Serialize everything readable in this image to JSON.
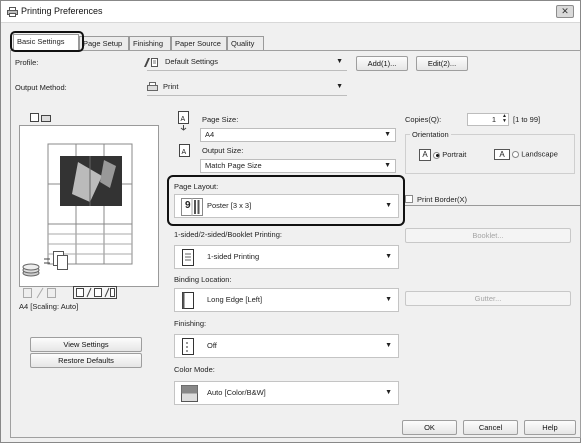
{
  "window": {
    "title": "Printing Preferences",
    "close_label": "✕"
  },
  "tabs": [
    {
      "label": "Basic Settings"
    },
    {
      "label": "Page Setup"
    },
    {
      "label": "Finishing"
    },
    {
      "label": "Paper Source"
    },
    {
      "label": "Quality"
    }
  ],
  "profile": {
    "label": "Profile:",
    "value": "Default Settings",
    "add_button": "Add(1)...",
    "edit_button": "Edit(2)..."
  },
  "output_method": {
    "label": "Output Method:",
    "value": "Print"
  },
  "page_size": {
    "label": "Page Size:",
    "value": "A4"
  },
  "output_size": {
    "label": "Output Size:",
    "value": "Match Page Size"
  },
  "page_layout": {
    "label": "Page Layout:",
    "value": "Poster [3 x 3]",
    "icon_number": "9"
  },
  "sided": {
    "label": "1-sided/2-sided/Booklet Printing:",
    "value": "1-sided Printing"
  },
  "binding": {
    "label": "Binding Location:",
    "value": "Long Edge [Left]"
  },
  "finishing": {
    "label": "Finishing:",
    "value": "Off"
  },
  "color_mode": {
    "label": "Color Mode:",
    "value": "Auto [Color/B&W]"
  },
  "copies": {
    "label": "Copies(Q):",
    "value": "1",
    "range": "[1 to 99]"
  },
  "orientation": {
    "label": "Orientation",
    "portrait": "Portrait",
    "landscape": "Landscape",
    "selected": "Portrait"
  },
  "print_border": {
    "label": "Print Border(X)",
    "checked": false
  },
  "booklet_button": "Booklet...",
  "gutter_button": "Gutter...",
  "preview": {
    "caption": "A4 [Scaling: Auto]"
  },
  "view_settings_button": "View Settings",
  "restore_defaults_button": "Restore Defaults",
  "footer": {
    "ok": "OK",
    "cancel": "Cancel",
    "help": "Help"
  }
}
